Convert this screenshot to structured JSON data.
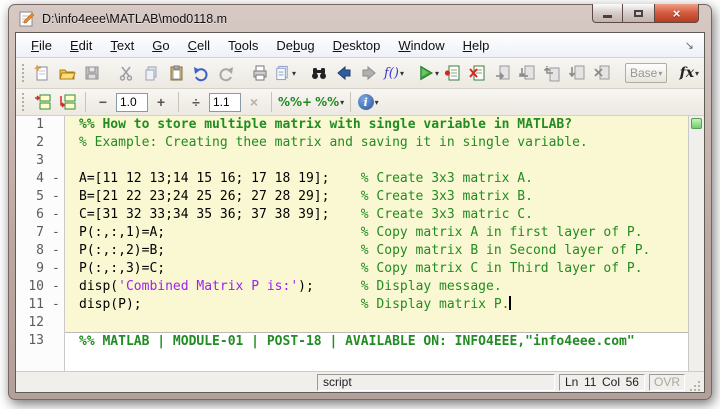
{
  "window": {
    "title": "D:\\info4eee\\MATLAB\\mod0118.m"
  },
  "menu": {
    "items": [
      {
        "label": "File",
        "u": 0
      },
      {
        "label": "Edit",
        "u": 0
      },
      {
        "label": "Text",
        "u": 0
      },
      {
        "label": "Go",
        "u": 0
      },
      {
        "label": "Cell",
        "u": 0
      },
      {
        "label": "Tools",
        "u": 1
      },
      {
        "label": "Debug",
        "u": 2
      },
      {
        "label": "Desktop",
        "u": 0
      },
      {
        "label": "Window",
        "u": 0
      },
      {
        "label": "Help",
        "u": 0
      }
    ]
  },
  "toolbar_main": {
    "insert_function_label": "f()",
    "workspace_label": "Base",
    "function_browser_label": "fx"
  },
  "toolbar_cell": {
    "minus_label": "−",
    "plus_label": "+",
    "divide_label": "÷",
    "multiply_label": "×",
    "add_value": "1.0",
    "multiply_value": "1.1",
    "percent_label": "%%",
    "info_label": "i"
  },
  "editor": {
    "lines": [
      {
        "n": "1",
        "exec": false,
        "cell": "y",
        "tokens": [
          [
            "cell",
            "%% How to store multiple matrix with single variable in MATLAB?"
          ]
        ]
      },
      {
        "n": "2",
        "exec": false,
        "cell": "y",
        "tokens": [
          [
            "comment",
            "% Example: Creating thee matrix and saving it in single variable."
          ]
        ]
      },
      {
        "n": "3",
        "exec": false,
        "cell": "y",
        "tokens": []
      },
      {
        "n": "4",
        "exec": true,
        "cell": "y",
        "tokens": [
          [
            "code",
            "A=[11 12 13;14 15 16; 17 18 19];    "
          ],
          [
            "comment",
            "% Create 3x3 matrix A."
          ]
        ]
      },
      {
        "n": "5",
        "exec": true,
        "cell": "y",
        "tokens": [
          [
            "code",
            "B=[21 22 23;24 25 26; 27 28 29];    "
          ],
          [
            "comment",
            "% Create 3x3 matrix B."
          ]
        ]
      },
      {
        "n": "6",
        "exec": true,
        "cell": "y",
        "tokens": [
          [
            "code",
            "C=[31 32 33;34 35 36; 37 38 39];    "
          ],
          [
            "comment",
            "% Create 3x3 matric C."
          ]
        ]
      },
      {
        "n": "7",
        "exec": true,
        "cell": "y",
        "tokens": [
          [
            "code",
            "P(:,:,1)=A;                         "
          ],
          [
            "comment",
            "% Copy matrix A in first layer of P."
          ]
        ]
      },
      {
        "n": "8",
        "exec": true,
        "cell": "y",
        "tokens": [
          [
            "code",
            "P(:,:,2)=B;                         "
          ],
          [
            "comment",
            "% Copy matrix B in Second layer of P."
          ]
        ]
      },
      {
        "n": "9",
        "exec": true,
        "cell": "y",
        "tokens": [
          [
            "code",
            "P(:,:,3)=C;                         "
          ],
          [
            "comment",
            "% Copy matrix C in Third layer of P."
          ]
        ]
      },
      {
        "n": "10",
        "exec": true,
        "cell": "y",
        "tokens": [
          [
            "code",
            "disp("
          ],
          [
            "string",
            "'Combined Matrix P is:'"
          ],
          [
            "code",
            ");      "
          ],
          [
            "comment",
            "% Display message."
          ]
        ]
      },
      {
        "n": "11",
        "exec": true,
        "cell": "y",
        "caret": true,
        "tokens": [
          [
            "code",
            "disp(P);                            "
          ],
          [
            "comment",
            "% Display matrix P."
          ]
        ]
      },
      {
        "n": "12",
        "exec": false,
        "cell": "y",
        "tokens": []
      },
      {
        "n": "13",
        "exec": false,
        "cell": "w",
        "tokens": [
          [
            "cell",
            "%% MATLAB | MODULE-01 | POST-18 | AVAILABLE ON: INFO4EEE,\"info4eee.com\""
          ]
        ]
      }
    ]
  },
  "status": {
    "file_type": "script",
    "ln_label": "Ln",
    "ln_value": "11",
    "col_label": "Col",
    "col_value": "56",
    "ovr_label": "OVR"
  }
}
